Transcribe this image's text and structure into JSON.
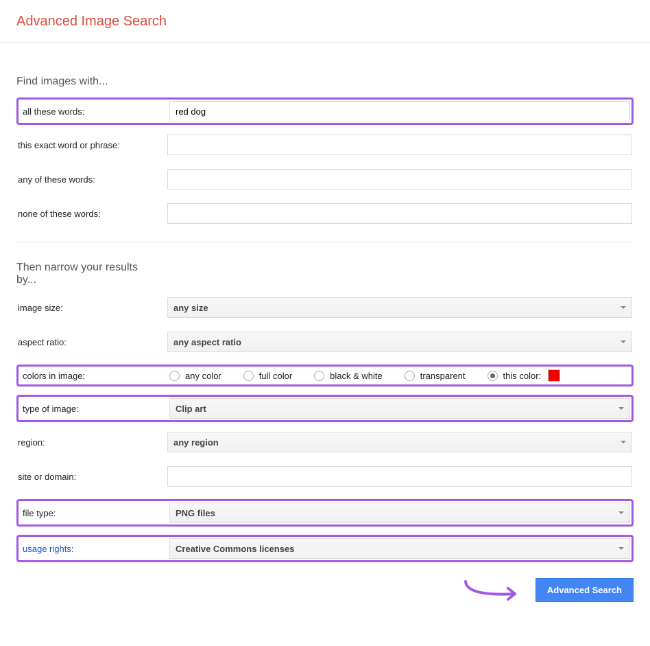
{
  "header": {
    "title": "Advanced Image Search"
  },
  "sections": {
    "find_title": "Find images with...",
    "narrow_title": "Then narrow your results by..."
  },
  "find": {
    "all_words_label": "all these words:",
    "all_words_value": "red dog",
    "exact_label": "this exact word or phrase:",
    "exact_value": "",
    "any_label": "any of these words:",
    "any_value": "",
    "none_label": "none of these words:",
    "none_value": ""
  },
  "narrow": {
    "size_label": "image size:",
    "size_value": "any size",
    "aspect_label": "aspect ratio:",
    "aspect_value": "any aspect ratio",
    "colors_label": "colors in image:",
    "colors_options": {
      "any": "any color",
      "full": "full color",
      "bw": "black & white",
      "transparent": "transparent",
      "this_color": "this color:"
    },
    "colors_selected": "this_color",
    "color_swatch_hex": "#ee0000",
    "type_label": "type of image:",
    "type_value": "Clip art",
    "region_label": "region:",
    "region_value": "any region",
    "site_label": "site or domain:",
    "site_value": "",
    "filetype_label": "file type:",
    "filetype_value": "PNG files",
    "usage_label": "usage rights:",
    "usage_value": "Creative Commons licenses"
  },
  "submit_label": "Advanced Search",
  "highlight_color": "#a259e6"
}
